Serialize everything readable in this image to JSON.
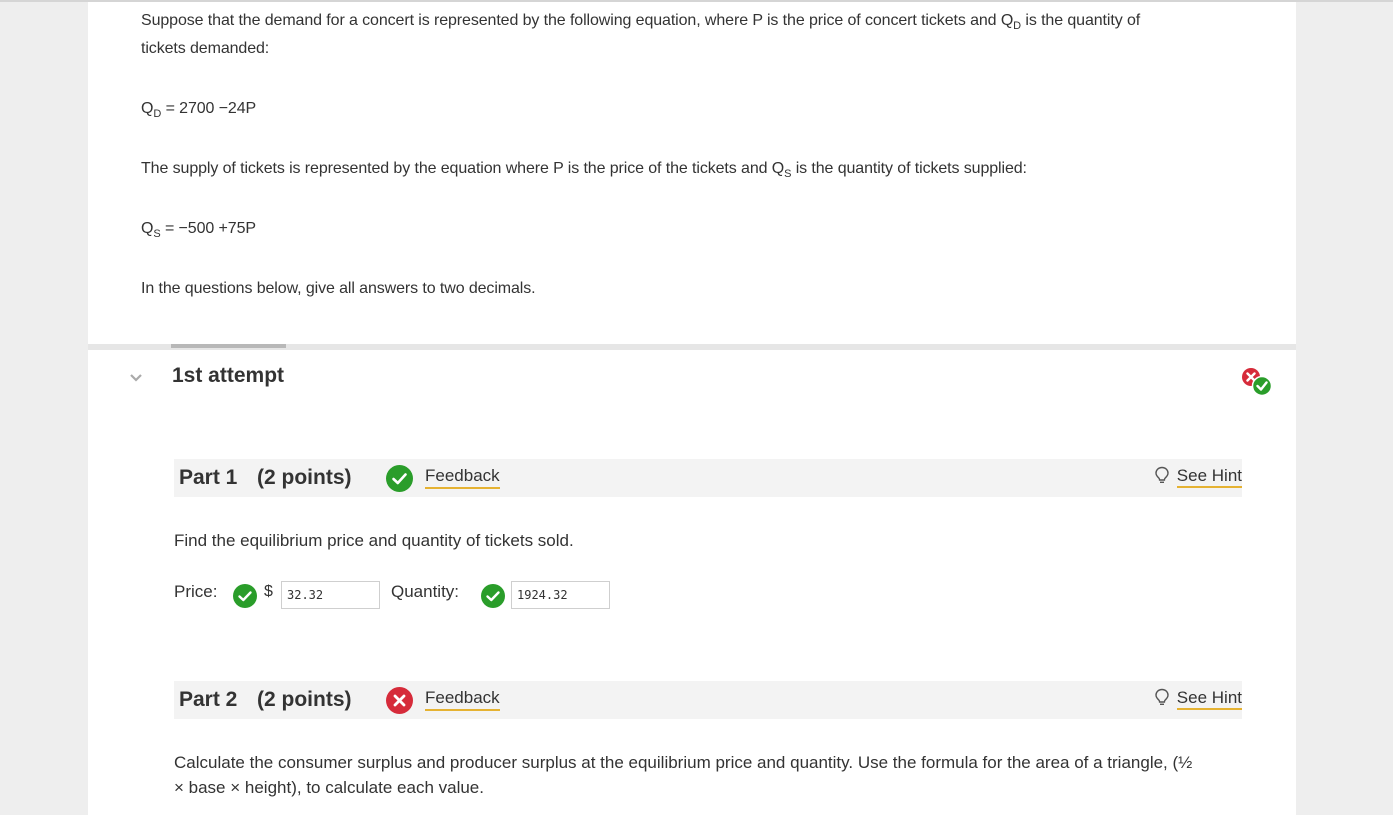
{
  "problem": {
    "intro_part1": "Suppose that the demand for a concert is represented by the following equation, where P is the price of concert tickets and Q",
    "intro_sub": "D",
    "intro_part2": " is the quantity of",
    "intro_line2": "tickets demanded:",
    "demand_q": "Q",
    "demand_sub": "D",
    "demand_eq": " = 2700 −24P",
    "supply_intro_part1": "The supply of tickets is represented by the equation where P is the price of the tickets and Q",
    "supply_intro_sub": "S",
    "supply_intro_part2": " is the quantity of tickets supplied:",
    "supply_q": "Q",
    "supply_sub": "S",
    "supply_eq": " = −500 +75P",
    "instruction": "In the questions below, give all answers to two decimals."
  },
  "attempt": {
    "title": "1st attempt",
    "chevron_icon": "chevron-down-icon",
    "status_icon": "mixed-result-icon"
  },
  "parts": [
    {
      "title": "Part 1",
      "points": "(2 points)",
      "status": "correct",
      "feedback_label": "Feedback",
      "hint_label": "See Hint",
      "question": "Find the equilibrium price and quantity of tickets sold.",
      "price_label": "Price:",
      "currency": "$",
      "price_value": "32.32",
      "quantity_label": "Quantity:",
      "quantity_value": "1924.32"
    },
    {
      "title": "Part 2",
      "points": "(2 points)",
      "status": "incorrect",
      "feedback_label": "Feedback",
      "hint_label": "See Hint",
      "question_line1": "Calculate the consumer surplus and producer surplus at the equilibrium price and quantity. Use the formula for the area of a triangle, (½",
      "question_line2": "× base × height), to calculate each value."
    }
  ],
  "colors": {
    "correct": "#2a9d2a",
    "incorrect": "#d62b3a",
    "link_underline": "#e5b232"
  }
}
